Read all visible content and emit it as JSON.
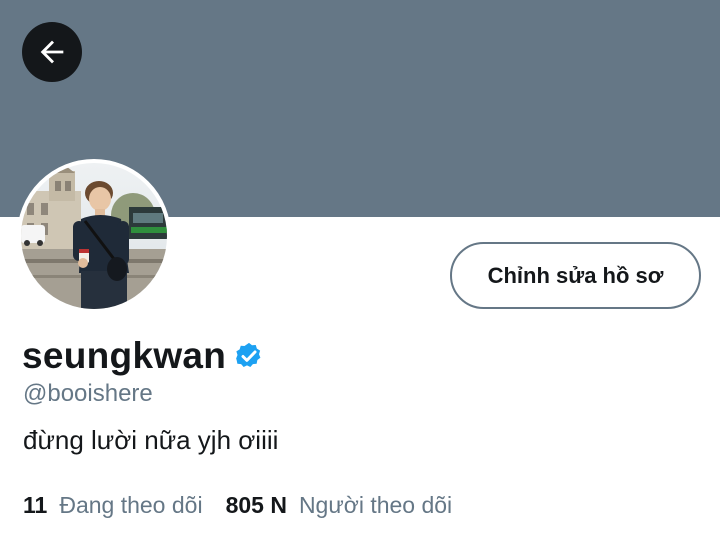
{
  "header": {
    "banner_color": "#657786",
    "back_icon": "arrow-left-icon"
  },
  "profile": {
    "avatar": "profile-photo",
    "edit_button_label": "Chỉnh sửa hồ sơ",
    "display_name": "seungkwan",
    "verified_icon": "verified-badge-icon",
    "verified_color": "#1da1f2",
    "handle": "@booishere",
    "bio": "đừng lười nữa yjh ơiiii"
  },
  "stats": {
    "following_count": "11",
    "following_label": "Đang theo dõi",
    "followers_count": "805 N",
    "followers_label": "Người theo dõi"
  }
}
